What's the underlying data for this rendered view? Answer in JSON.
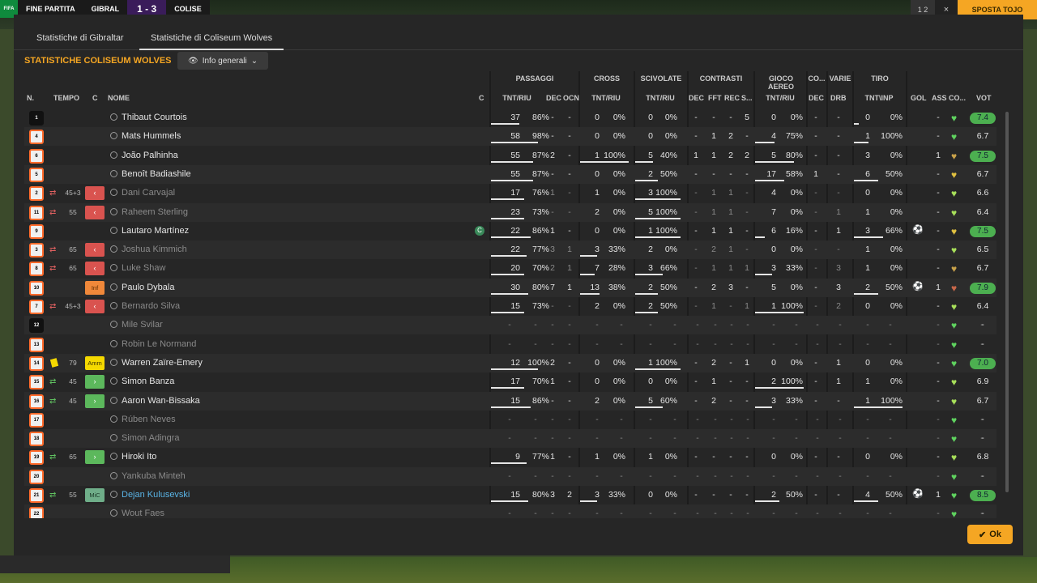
{
  "topbar": {
    "label": "FINE PARTITA",
    "home": "GIBRAL",
    "score": "1 - 3",
    "away": "COLISE",
    "page": "1 2",
    "close": "×",
    "action": "SPOSTA TOJO"
  },
  "tabs": [
    {
      "label": "Statistiche di Gibraltar"
    },
    {
      "label": "Statistiche di Coliseum Wolves"
    }
  ],
  "section_title": "STATISTICHE COLISEUM WOLVES",
  "view_dropdown": "Info generali",
  "groups": {
    "passaggi": "PASSAGGI",
    "cross": "CROSS",
    "scivolate": "SCIVOLATE",
    "contrasti": "CONTRASTI",
    "aereo": "GIOCO AEREO",
    "co": "CO...",
    "varie": "VARIE",
    "tiro": "TIRO"
  },
  "columns": {
    "n": "N.",
    "tempo": "TEMPO",
    "c": "C",
    "nome": "NOME",
    "c2": "C",
    "pass_tr": "TNT/RIU",
    "pass_dec": "DEC",
    "pass_ocn": "OCN",
    "cross_tr": "TNT/RIU",
    "sciv_tr": "TNT/RIU",
    "con_dec": "DEC",
    "con_fft": "FFT",
    "con_rec": "REC",
    "con_s": "S...",
    "aer_tr": "TNT/RIU",
    "co_dec": "DEC",
    "var_drb": "DRB",
    "tiro_tr": "TNT\\INP",
    "gol": "GOL",
    "ass": "ASS",
    "co2": "CO...",
    "vot": "VOT"
  },
  "players": [
    {
      "n": "1",
      "gk": true,
      "name": "Thibaut Courtois",
      "pt": "37",
      "pr": "86%",
      "pd": "-",
      "po": "-",
      "ct": "0",
      "cr": "0%",
      "st": "0",
      "sr": "0%",
      "kd": "-",
      "kf": "-",
      "kr": "-",
      "ks": "5",
      "at": "0",
      "ar": "0%",
      "od": "-",
      "vd": "-",
      "tt": "0",
      "tr": "0%",
      "ass": "-",
      "heart": "#5fd35f",
      "vot": "7.4",
      "vc": "#4caf50",
      "bars": [
        0.6,
        0,
        0,
        0,
        0.1
      ]
    },
    {
      "n": "4",
      "name": "Mats Hummels",
      "pt": "58",
      "pr": "98%",
      "pd": "-",
      "po": "-",
      "ct": "0",
      "cr": "0%",
      "st": "0",
      "sr": "0%",
      "kd": "-",
      "kf": "1",
      "kr": "2",
      "ks": "-",
      "at": "4",
      "ar": "75%",
      "od": "-",
      "vd": "-",
      "tt": "1",
      "tr": "100%",
      "ass": "-",
      "heart": "#5fd35f",
      "vot": "6.7",
      "bars": [
        1,
        0,
        0,
        0.4,
        0.3
      ]
    },
    {
      "n": "6",
      "name": "João Palhinha",
      "pt": "55",
      "pr": "87%",
      "pd": "2",
      "po": "-",
      "ct": "1",
      "cr": "100%",
      "st": "5",
      "sr": "40%",
      "kd": "1",
      "kf": "1",
      "kr": "2",
      "ks": "2",
      "at": "5",
      "ar": "80%",
      "od": "-",
      "vd": "-",
      "tt": "3",
      "tr": "0%",
      "ass": "1",
      "heart": "#c9a24a",
      "vot": "7.5",
      "vc": "#4caf50",
      "bars": [
        0.9,
        1,
        0.4,
        0.8,
        0
      ]
    },
    {
      "n": "5",
      "name": "Benoît Badiashile",
      "pt": "55",
      "pr": "87%",
      "pd": "-",
      "po": "-",
      "ct": "0",
      "cr": "0%",
      "st": "2",
      "sr": "50%",
      "kd": "-",
      "kf": "-",
      "kr": "-",
      "ks": "-",
      "at": "17",
      "ar": "58%",
      "od": "1",
      "vd": "-",
      "tt": "6",
      "tr": "50%",
      "ass": "-",
      "heart": "#e0c040",
      "vot": "6.7",
      "bars": [
        0.9,
        0,
        0.5,
        0.6,
        0.5
      ]
    },
    {
      "n": "2",
      "name": "Dani Carvajal",
      "dim": true,
      "tempo": "45+3",
      "sub": "out",
      "pt": "17",
      "pr": "76%",
      "pd": "1",
      "po": "-",
      "ct": "1",
      "cr": "0%",
      "st": "3",
      "sr": "100%",
      "kd": "-",
      "kf": "1",
      "kr": "1",
      "ks": "-",
      "at": "4",
      "ar": "0%",
      "od": "-",
      "vd": "-",
      "tt": "0",
      "tr": "0%",
      "ass": "-",
      "heart": "#a8e05a",
      "vot": "6.6",
      "bars": [
        0.7,
        0,
        1,
        0,
        0
      ]
    },
    {
      "n": "11",
      "name": "Raheem Sterling",
      "dim": true,
      "tempo": "55",
      "sub": "out",
      "pt": "23",
      "pr": "73%",
      "pd": "-",
      "po": "-",
      "ct": "2",
      "cr": "0%",
      "st": "5",
      "sr": "100%",
      "kd": "-",
      "kf": "1",
      "kr": "1",
      "ks": "-",
      "at": "7",
      "ar": "0%",
      "od": "-",
      "vd": "1",
      "tt": "1",
      "tr": "0%",
      "ass": "-",
      "heart": "#a8e05a",
      "vot": "6.4",
      "bars": [
        0.7,
        0,
        1,
        0,
        0
      ]
    },
    {
      "n": "9",
      "name": "Lautaro Martínez",
      "cap": true,
      "pt": "22",
      "pr": "86%",
      "pd": "1",
      "po": "-",
      "ct": "0",
      "cr": "0%",
      "st": "1",
      "sr": "100%",
      "kd": "-",
      "kf": "1",
      "kr": "1",
      "ks": "-",
      "at": "6",
      "ar": "16%",
      "od": "-",
      "vd": "1",
      "tt": "3",
      "tr": "66%",
      "gol": true,
      "ass": "-",
      "heart": "#e0c040",
      "vot": "7.5",
      "vc": "#4caf50",
      "bars": [
        0.85,
        0,
        1,
        0.2,
        0.6
      ]
    },
    {
      "n": "3",
      "name": "Joshua Kimmich",
      "dim": true,
      "tempo": "65",
      "sub": "out",
      "pt": "22",
      "pr": "77%",
      "pd": "3",
      "po": "1",
      "ct": "3",
      "cr": "33%",
      "st": "2",
      "sr": "0%",
      "kd": "-",
      "kf": "2",
      "kr": "1",
      "ks": "-",
      "at": "0",
      "ar": "0%",
      "od": "-",
      "vd": "-",
      "tt": "1",
      "tr": "0%",
      "ass": "-",
      "heart": "#a8e05a",
      "vot": "6.5",
      "bars": [
        0.75,
        0.35,
        0,
        0,
        0
      ]
    },
    {
      "n": "8",
      "name": "Luke Shaw",
      "dim": true,
      "tempo": "65",
      "sub": "out",
      "pt": "20",
      "pr": "70%",
      "pd": "2",
      "po": "1",
      "ct": "7",
      "cr": "28%",
      "st": "3",
      "sr": "66%",
      "kd": "-",
      "kf": "1",
      "kr": "1",
      "ks": "1",
      "at": "3",
      "ar": "33%",
      "od": "-",
      "vd": "3",
      "tt": "1",
      "tr": "0%",
      "ass": "-",
      "heart": "#c9a24a",
      "vot": "6.7",
      "bars": [
        0.7,
        0.3,
        0.6,
        0.35,
        0
      ]
    },
    {
      "n": "10",
      "name": "Paulo Dybala",
      "badge": "Inf",
      "pt": "30",
      "pr": "80%",
      "pd": "7",
      "po": "1",
      "ct": "13",
      "cr": "38%",
      "st": "2",
      "sr": "50%",
      "kd": "-",
      "kf": "2",
      "kr": "3",
      "ks": "-",
      "at": "5",
      "ar": "0%",
      "od": "-",
      "vd": "3",
      "tt": "2",
      "tr": "50%",
      "gol": true,
      "ass": "1",
      "heart": "#c9674a",
      "vot": "7.9",
      "vc": "#4caf50",
      "bars": [
        0.8,
        0.4,
        0.5,
        0,
        0.5
      ]
    },
    {
      "n": "7",
      "name": "Bernardo Silva",
      "dim": true,
      "tempo": "45+3",
      "sub": "out",
      "pt": "15",
      "pr": "73%",
      "pd": "-",
      "po": "-",
      "ct": "2",
      "cr": "0%",
      "st": "2",
      "sr": "50%",
      "kd": "-",
      "kf": "1",
      "kr": "-",
      "ks": "1",
      "at": "1",
      "ar": "100%",
      "od": "-",
      "vd": "2",
      "tt": "0",
      "tr": "0%",
      "ass": "-",
      "heart": "#a8e05a",
      "vot": "6.4",
      "bars": [
        0.7,
        0,
        0.5,
        1,
        0
      ]
    },
    {
      "n": "12",
      "gk": true,
      "name": "Mile Svilar",
      "dim": true,
      "empty": true,
      "heart": "#5fd35f",
      "vot": "-"
    },
    {
      "n": "13",
      "name": "Robin Le Normand",
      "dim": true,
      "empty": true,
      "heart": "#5fd35f",
      "vot": "-"
    },
    {
      "n": "14",
      "name": "Warren Zaïre-Emery",
      "yellow": true,
      "tempo": "79",
      "badge": "Amm",
      "pt": "12",
      "pr": "100%",
      "pd": "2",
      "po": "-",
      "ct": "0",
      "cr": "0%",
      "st": "1",
      "sr": "100%",
      "kd": "-",
      "kf": "2",
      "kr": "-",
      "ks": "1",
      "at": "0",
      "ar": "0%",
      "od": "-",
      "vd": "1",
      "tt": "0",
      "tr": "0%",
      "ass": "-",
      "heart": "#5fd35f",
      "vot": "7.0",
      "vc": "#4caf50",
      "bars": [
        1,
        0,
        1,
        0,
        0
      ]
    },
    {
      "n": "15",
      "name": "Simon Banza",
      "tempo": "45",
      "sub": "in",
      "pt": "17",
      "pr": "70%",
      "pd": "1",
      "po": "-",
      "ct": "0",
      "cr": "0%",
      "st": "0",
      "sr": "0%",
      "kd": "-",
      "kf": "1",
      "kr": "-",
      "ks": "-",
      "at": "2",
      "ar": "100%",
      "od": "-",
      "vd": "1",
      "tt": "1",
      "tr": "0%",
      "ass": "-",
      "heart": "#a8e05a",
      "vot": "6.9",
      "bars": [
        0.7,
        0,
        0,
        1,
        0
      ]
    },
    {
      "n": "16",
      "name": "Aaron Wan-Bissaka",
      "tempo": "45",
      "sub": "in",
      "pt": "15",
      "pr": "86%",
      "pd": "-",
      "po": "-",
      "ct": "2",
      "cr": "0%",
      "st": "5",
      "sr": "60%",
      "kd": "-",
      "kf": "2",
      "kr": "-",
      "ks": "-",
      "at": "3",
      "ar": "33%",
      "od": "-",
      "vd": "-",
      "tt": "1",
      "tr": "100%",
      "ass": "-",
      "heart": "#a8e05a",
      "vot": "6.7",
      "bars": [
        0.85,
        0,
        0.6,
        0.35,
        1
      ]
    },
    {
      "n": "17",
      "name": "Rúben Neves",
      "dim": true,
      "empty": true,
      "heart": "#5fd35f",
      "vot": "-"
    },
    {
      "n": "18",
      "name": "Simon Adingra",
      "dim": true,
      "empty": true,
      "heart": "#5fd35f",
      "vot": "-"
    },
    {
      "n": "19",
      "name": "Hiroki Ito",
      "tempo": "65",
      "sub": "in",
      "pt": "9",
      "pr": "77%",
      "pd": "1",
      "po": "-",
      "ct": "1",
      "cr": "0%",
      "st": "1",
      "sr": "0%",
      "kd": "-",
      "kf": "-",
      "kr": "-",
      "ks": "-",
      "at": "0",
      "ar": "0%",
      "od": "-",
      "vd": "-",
      "tt": "0",
      "tr": "0%",
      "ass": "-",
      "heart": "#a8e05a",
      "vot": "6.8",
      "bars": [
        0.75,
        0,
        0,
        0,
        0
      ]
    },
    {
      "n": "20",
      "name": "Yankuba Minteh",
      "dim": true,
      "empty": true,
      "heart": "#5fd35f",
      "vot": "-"
    },
    {
      "n": "21",
      "name": "Dejan Kulusevski",
      "link": true,
      "tempo": "55",
      "badge": "MiC",
      "sub": "in",
      "pt": "15",
      "pr": "80%",
      "pd": "3",
      "po": "2",
      "ct": "3",
      "cr": "33%",
      "st": "0",
      "sr": "0%",
      "kd": "-",
      "kf": "-",
      "kr": "-",
      "ks": "-",
      "at": "2",
      "ar": "50%",
      "od": "-",
      "vd": "-",
      "tt": "4",
      "tr": "50%",
      "gol": true,
      "ass": "1",
      "heart": "#5fd35f",
      "vot": "8.5",
      "vc": "#4caf50",
      "bars": [
        0.8,
        0.35,
        0,
        0.5,
        0.5
      ]
    },
    {
      "n": "22",
      "name": "Wout Faes",
      "dim": true,
      "empty": true,
      "heart": "#5fd35f",
      "vot": "-"
    }
  ],
  "ok_label": "Ok"
}
